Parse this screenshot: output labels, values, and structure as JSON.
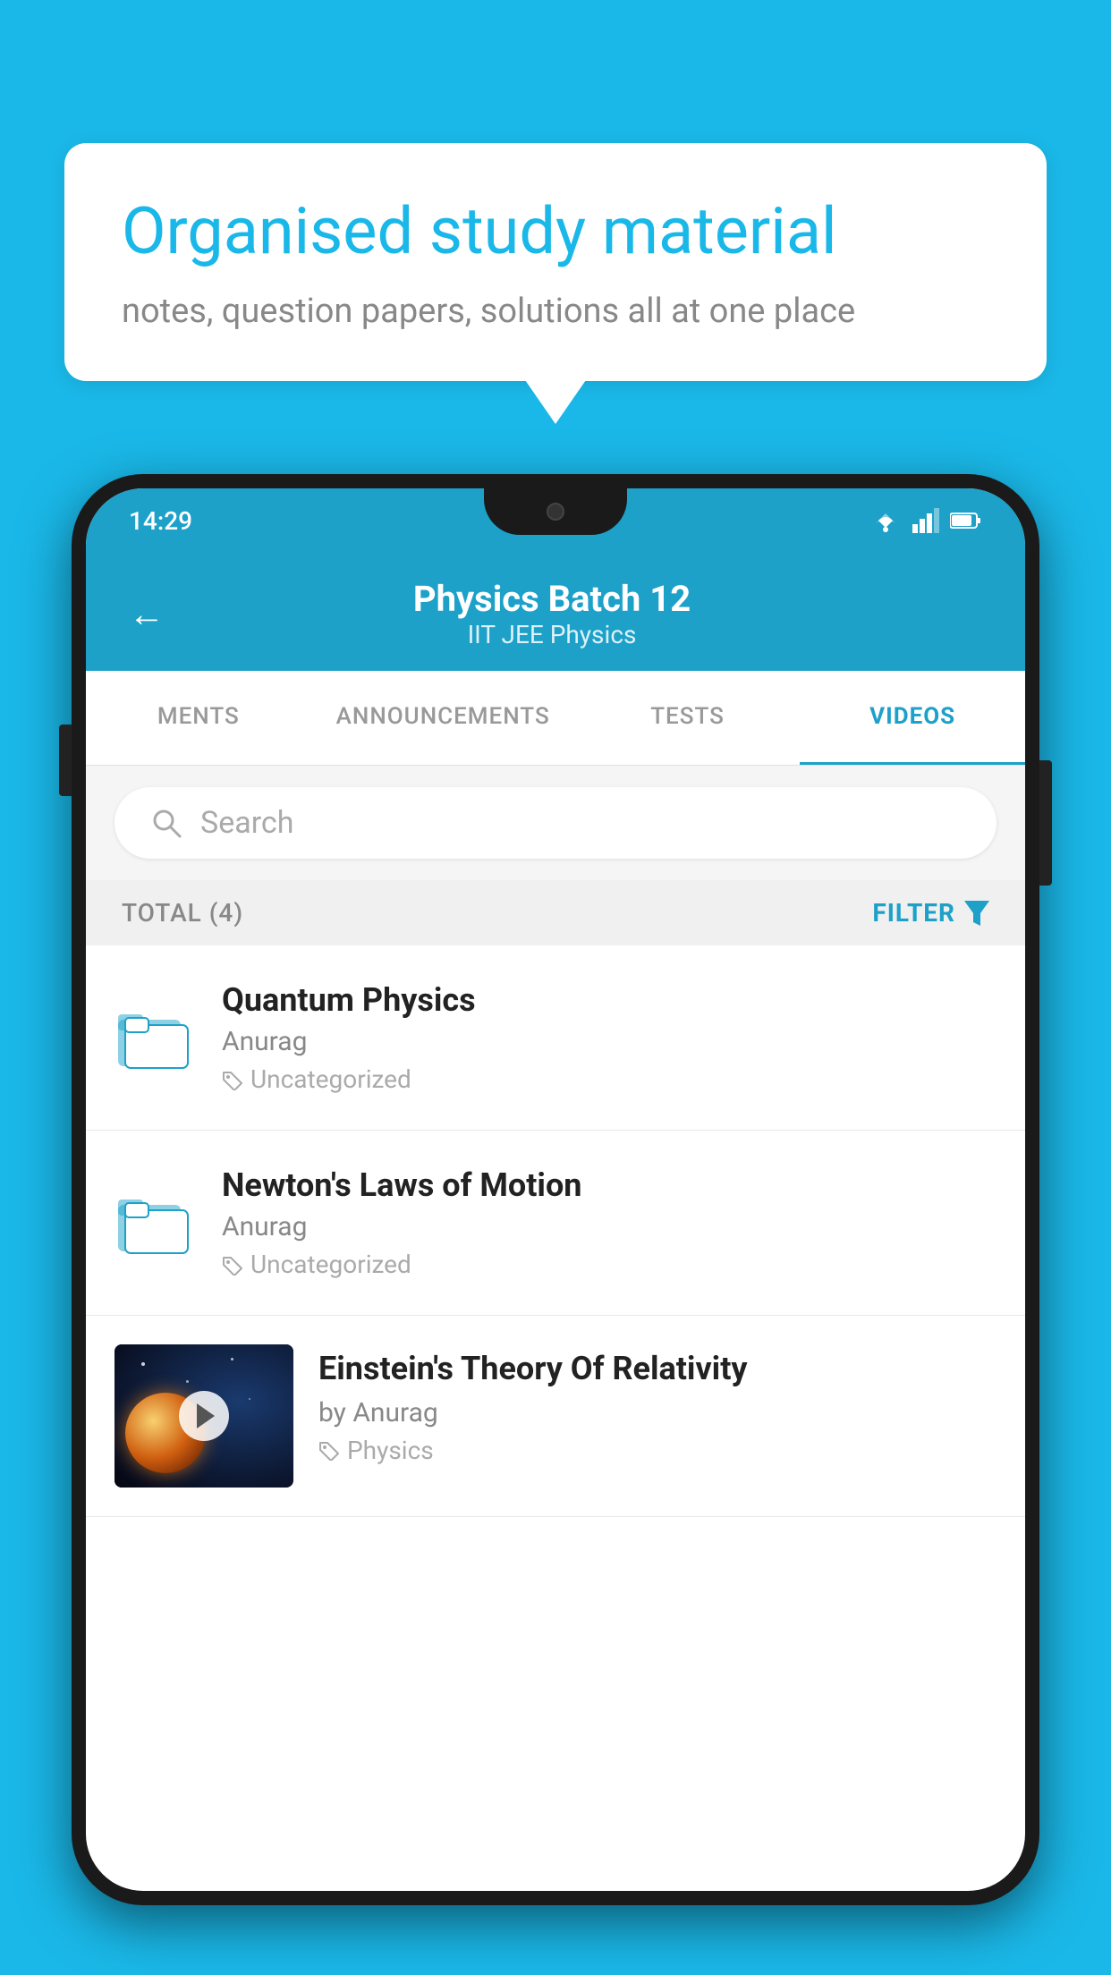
{
  "background_color": "#1ab8e8",
  "speech_bubble": {
    "heading": "Organised study material",
    "subtext": "notes, question papers, solutions all at one place"
  },
  "phone": {
    "status_bar": {
      "time": "14:29",
      "icons": [
        "wifi",
        "signal",
        "battery"
      ]
    },
    "app_header": {
      "back_label": "←",
      "title": "Physics Batch 12",
      "subtitle": "IIT JEE    Physics"
    },
    "tabs": [
      {
        "label": "MENTS",
        "active": false
      },
      {
        "label": "ANNOUNCEMENTS",
        "active": false
      },
      {
        "label": "TESTS",
        "active": false
      },
      {
        "label": "VIDEOS",
        "active": true
      }
    ],
    "search": {
      "placeholder": "Search"
    },
    "filter_bar": {
      "total_label": "TOTAL (4)",
      "filter_label": "FILTER"
    },
    "videos": [
      {
        "id": "1",
        "title": "Quantum Physics",
        "author": "Anurag",
        "tag": "Uncategorized",
        "has_thumbnail": false
      },
      {
        "id": "2",
        "title": "Newton's Laws of Motion",
        "author": "Anurag",
        "tag": "Uncategorized",
        "has_thumbnail": false
      },
      {
        "id": "3",
        "title": "Einstein's Theory Of Relativity",
        "author": "by Anurag",
        "tag": "Physics",
        "has_thumbnail": true
      }
    ]
  }
}
